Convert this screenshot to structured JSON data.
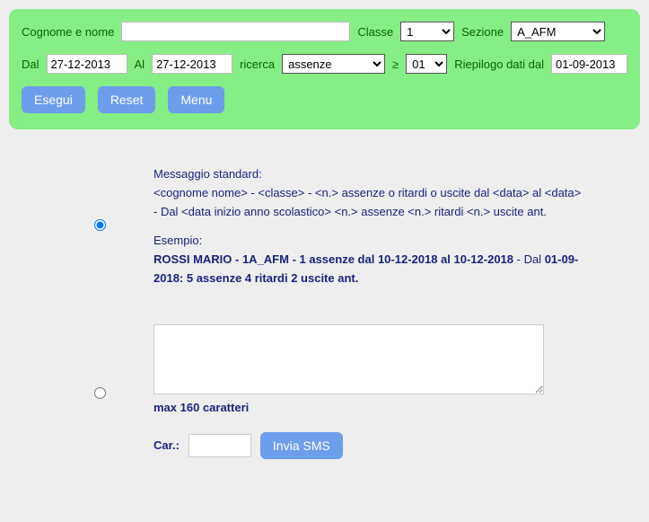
{
  "filter": {
    "cognome_label": "Cognome e nome",
    "cognome_value": "",
    "classe_label": "Classe",
    "classe_value": "1",
    "sezione_label": "Sezione",
    "sezione_value": "A_AFM",
    "dal_label": "Dal",
    "dal_value": "27-12-2013",
    "al_label": "Al",
    "al_value": "27-12-2013",
    "ricerca_label": "ricerca",
    "ricerca_value": "assenze",
    "gte_label": "≥",
    "gte_value": "01",
    "riepilogo_label": "Riepilogo dati dal",
    "riepilogo_value": "01-09-2013"
  },
  "buttons": {
    "esegui": "Esegui",
    "reset": "Reset",
    "menu": "Menu",
    "invia": "Invia SMS"
  },
  "message": {
    "standard_title": "Messaggio standard:",
    "standard_template": "<cognome nome> - <classe> - <n.> assenze o ritardi o uscite dal <data> al <data> - Dal <data inizio anno scolastico> <n.> assenze <n.> ritardi <n.> uscite ant.",
    "esempio_label": "Esempio:",
    "esempio_bold": "ROSSI MARIO - 1A_AFM - 1 assenze dal 10-12-2018 al 10-12-2018",
    "esempio_tail": " - Dal ",
    "esempio_bold2": "01-09-2018: 5 assenze 4 ritardi 2 uscite ant.",
    "max_chars": "max 160 caratteri",
    "car_label": "Car.:",
    "car_value": ""
  }
}
